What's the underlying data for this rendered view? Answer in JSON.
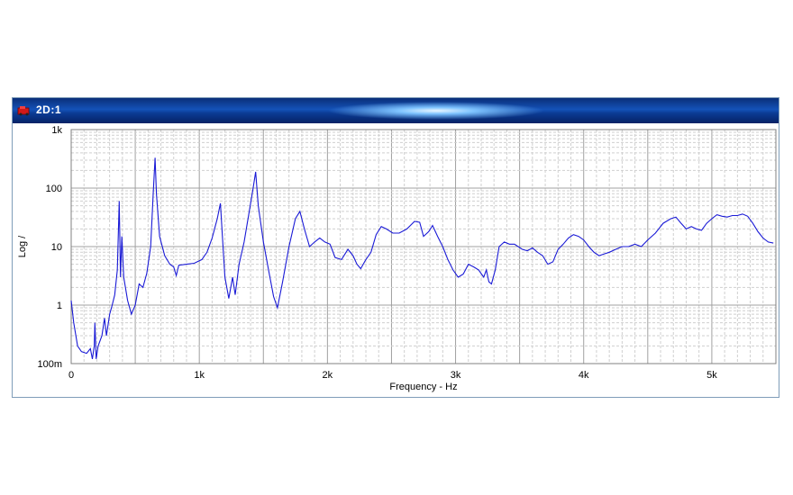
{
  "window": {
    "title": "2D:1",
    "colors": {
      "title_bar": "#1452b8",
      "trace": "#1a1ad6",
      "grid_major": "#a0a0a0",
      "grid_minor": "#cfcfcf"
    }
  },
  "chart_data": {
    "type": "line",
    "xlabel": "Frequency - Hz",
    "ylabel": "Log /",
    "y_scale": "log",
    "xlim": [
      0,
      5500
    ],
    "ylim": [
      0.1,
      1000
    ],
    "grid": true,
    "x_ticks": [
      {
        "value": 0,
        "label": "0"
      },
      {
        "value": 1000,
        "label": "1k"
      },
      {
        "value": 2000,
        "label": "2k"
      },
      {
        "value": 3000,
        "label": "3k"
      },
      {
        "value": 4000,
        "label": "4k"
      },
      {
        "value": 5000,
        "label": "5k"
      }
    ],
    "y_ticks": [
      {
        "value": 0.1,
        "label": "100m"
      },
      {
        "value": 1,
        "label": "1"
      },
      {
        "value": 10,
        "label": "10"
      },
      {
        "value": 100,
        "label": "100"
      },
      {
        "value": 1000,
        "label": "1k"
      }
    ],
    "series": [
      {
        "color": "#1a1ad6",
        "points": [
          [
            0,
            1.2
          ],
          [
            20,
            0.5
          ],
          [
            50,
            0.2
          ],
          [
            80,
            0.16
          ],
          [
            120,
            0.15
          ],
          [
            150,
            0.18
          ],
          [
            165,
            0.12
          ],
          [
            180,
            0.2
          ],
          [
            185,
            0.5
          ],
          [
            195,
            0.12
          ],
          [
            210,
            0.2
          ],
          [
            240,
            0.3
          ],
          [
            260,
            0.6
          ],
          [
            275,
            0.3
          ],
          [
            300,
            0.7
          ],
          [
            320,
            1.0
          ],
          [
            340,
            1.5
          ],
          [
            360,
            4
          ],
          [
            375,
            60
          ],
          [
            385,
            3
          ],
          [
            395,
            15
          ],
          [
            410,
            3
          ],
          [
            440,
            1.2
          ],
          [
            470,
            0.7
          ],
          [
            500,
            1.0
          ],
          [
            530,
            2.3
          ],
          [
            560,
            2
          ],
          [
            590,
            3.5
          ],
          [
            620,
            10
          ],
          [
            640,
            80
          ],
          [
            655,
            330
          ],
          [
            665,
            80
          ],
          [
            690,
            15
          ],
          [
            730,
            7
          ],
          [
            770,
            5
          ],
          [
            800,
            4.5
          ],
          [
            820,
            3.2
          ],
          [
            840,
            4.8
          ],
          [
            900,
            5
          ],
          [
            960,
            5.2
          ],
          [
            1020,
            6
          ],
          [
            1060,
            8
          ],
          [
            1100,
            14
          ],
          [
            1140,
            30
          ],
          [
            1165,
            55
          ],
          [
            1180,
            15
          ],
          [
            1200,
            3
          ],
          [
            1230,
            1.3
          ],
          [
            1260,
            3
          ],
          [
            1280,
            1.5
          ],
          [
            1310,
            5
          ],
          [
            1350,
            12
          ],
          [
            1390,
            40
          ],
          [
            1420,
            100
          ],
          [
            1440,
            190
          ],
          [
            1460,
            50
          ],
          [
            1500,
            12
          ],
          [
            1540,
            4
          ],
          [
            1580,
            1.4
          ],
          [
            1610,
            0.9
          ],
          [
            1650,
            2.5
          ],
          [
            1700,
            10
          ],
          [
            1750,
            30
          ],
          [
            1785,
            40
          ],
          [
            1820,
            20
          ],
          [
            1860,
            10
          ],
          [
            1900,
            12
          ],
          [
            1940,
            14
          ],
          [
            1980,
            12
          ],
          [
            2020,
            11
          ],
          [
            2060,
            6.5
          ],
          [
            2110,
            6
          ],
          [
            2160,
            9
          ],
          [
            2200,
            7
          ],
          [
            2230,
            5
          ],
          [
            2260,
            4.2
          ],
          [
            2300,
            6
          ],
          [
            2340,
            8
          ],
          [
            2380,
            16
          ],
          [
            2420,
            22
          ],
          [
            2460,
            20
          ],
          [
            2510,
            17
          ],
          [
            2560,
            17
          ],
          [
            2620,
            20
          ],
          [
            2680,
            27
          ],
          [
            2720,
            26
          ],
          [
            2750,
            15
          ],
          [
            2790,
            18
          ],
          [
            2820,
            23
          ],
          [
            2860,
            15
          ],
          [
            2900,
            10
          ],
          [
            2940,
            6
          ],
          [
            2980,
            4
          ],
          [
            3020,
            3
          ],
          [
            3060,
            3.4
          ],
          [
            3100,
            5
          ],
          [
            3140,
            4.5
          ],
          [
            3180,
            4
          ],
          [
            3220,
            3
          ],
          [
            3240,
            4
          ],
          [
            3260,
            2.5
          ],
          [
            3280,
            2.3
          ],
          [
            3310,
            4
          ],
          [
            3340,
            10
          ],
          [
            3380,
            12
          ],
          [
            3420,
            11
          ],
          [
            3460,
            11
          ],
          [
            3520,
            9
          ],
          [
            3560,
            8.5
          ],
          [
            3600,
            9.5
          ],
          [
            3640,
            8
          ],
          [
            3680,
            7
          ],
          [
            3720,
            5
          ],
          [
            3760,
            5.5
          ],
          [
            3800,
            9
          ],
          [
            3840,
            11
          ],
          [
            3880,
            14
          ],
          [
            3920,
            16
          ],
          [
            3960,
            15
          ],
          [
            4000,
            13
          ],
          [
            4040,
            10
          ],
          [
            4080,
            8
          ],
          [
            4120,
            7
          ],
          [
            4160,
            7.5
          ],
          [
            4200,
            8
          ],
          [
            4250,
            9
          ],
          [
            4300,
            10
          ],
          [
            4350,
            10
          ],
          [
            4400,
            11
          ],
          [
            4450,
            10
          ],
          [
            4500,
            13
          ],
          [
            4560,
            17
          ],
          [
            4620,
            25
          ],
          [
            4680,
            30
          ],
          [
            4720,
            32
          ],
          [
            4760,
            25
          ],
          [
            4800,
            20
          ],
          [
            4840,
            22
          ],
          [
            4880,
            20
          ],
          [
            4920,
            19
          ],
          [
            4960,
            25
          ],
          [
            5000,
            30
          ],
          [
            5040,
            35
          ],
          [
            5080,
            33
          ],
          [
            5120,
            32
          ],
          [
            5160,
            34
          ],
          [
            5200,
            34
          ],
          [
            5240,
            36
          ],
          [
            5280,
            33
          ],
          [
            5320,
            25
          ],
          [
            5360,
            18
          ],
          [
            5400,
            14
          ],
          [
            5440,
            12
          ],
          [
            5480,
            11.5
          ]
        ]
      }
    ]
  }
}
